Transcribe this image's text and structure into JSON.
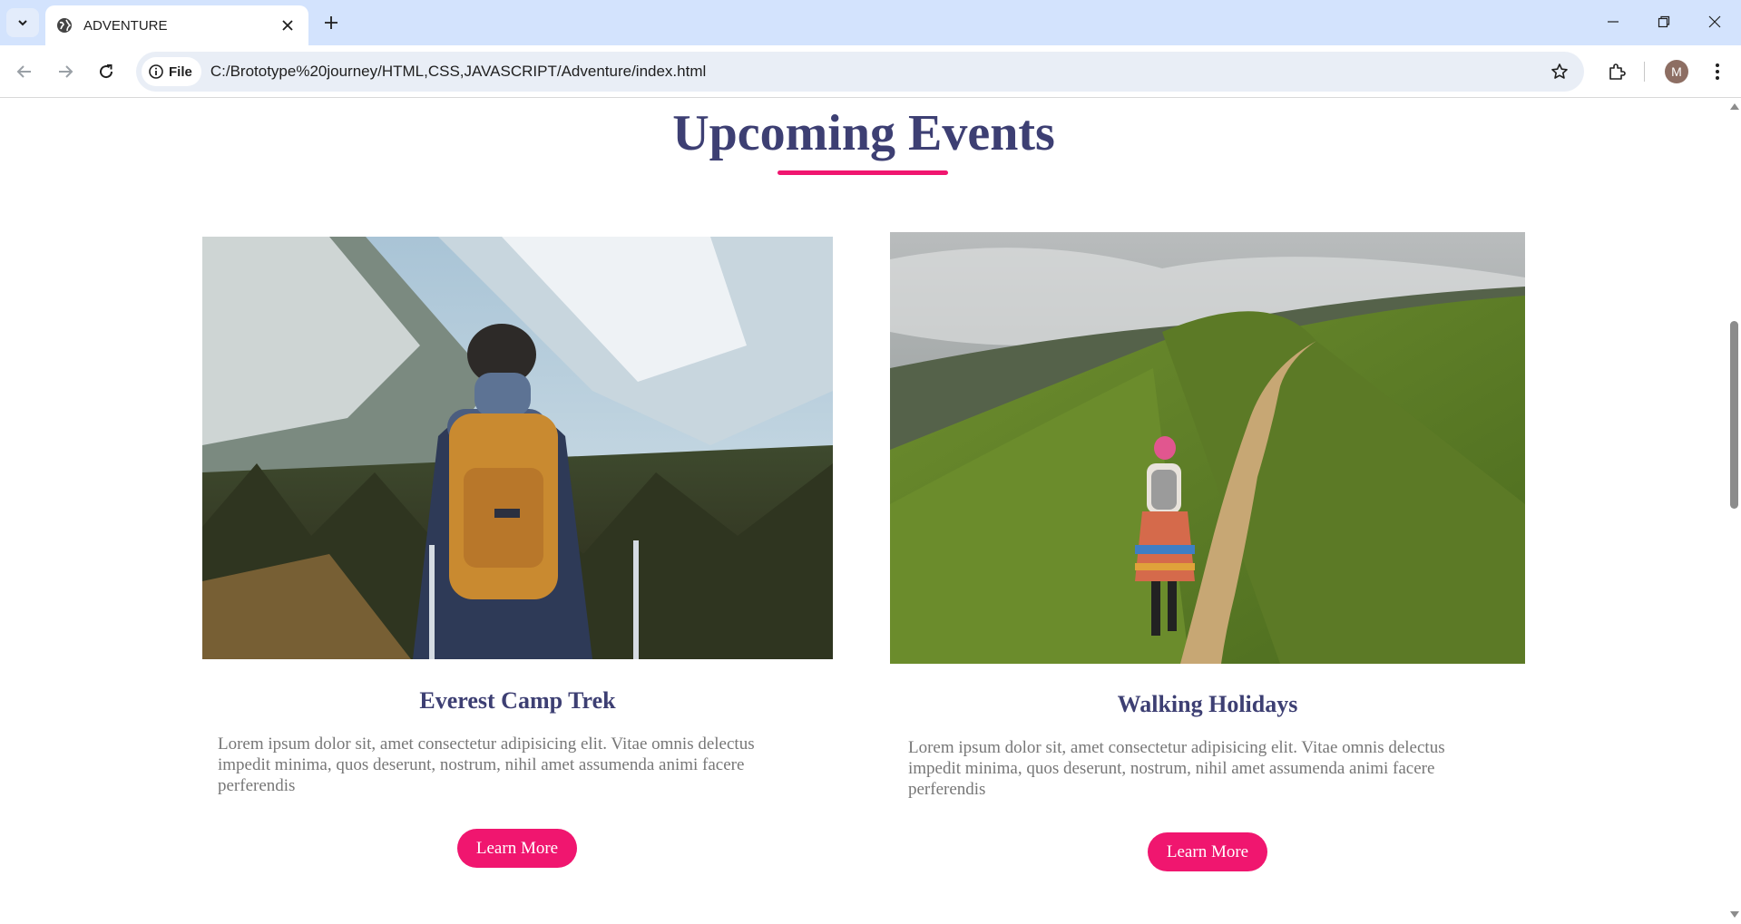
{
  "browser": {
    "tab_title": "ADVENTURE",
    "site_chip_label": "File",
    "url": "C:/Brototype%20journey/HTML,CSS,JAVASCRIPT/Adventure/index.html",
    "profile_initial": "M"
  },
  "page": {
    "section_title": "Upcoming Events",
    "accent_color": "#f0166f",
    "heading_color": "#3d3f73",
    "events": [
      {
        "title": "Everest Camp Trek",
        "description": "Lorem ipsum dolor sit, amet consectetur adipisicing elit. Vitae omnis delectus impedit minima, quos deserunt, nostrum, nihil amet assumenda animi facere perferendis",
        "button_label": "Learn More",
        "image": "hiker-with-backpack-snowy-mountains"
      },
      {
        "title": "Walking Holidays",
        "description": "Lorem ipsum dolor sit, amet consectetur adipisicing elit. Vitae omnis delectus impedit minima, quos deserunt, nostrum, nihil amet assumenda animi facere perferendis",
        "button_label": "Learn More",
        "image": "woman-walking-green-ridge-trail"
      }
    ]
  }
}
